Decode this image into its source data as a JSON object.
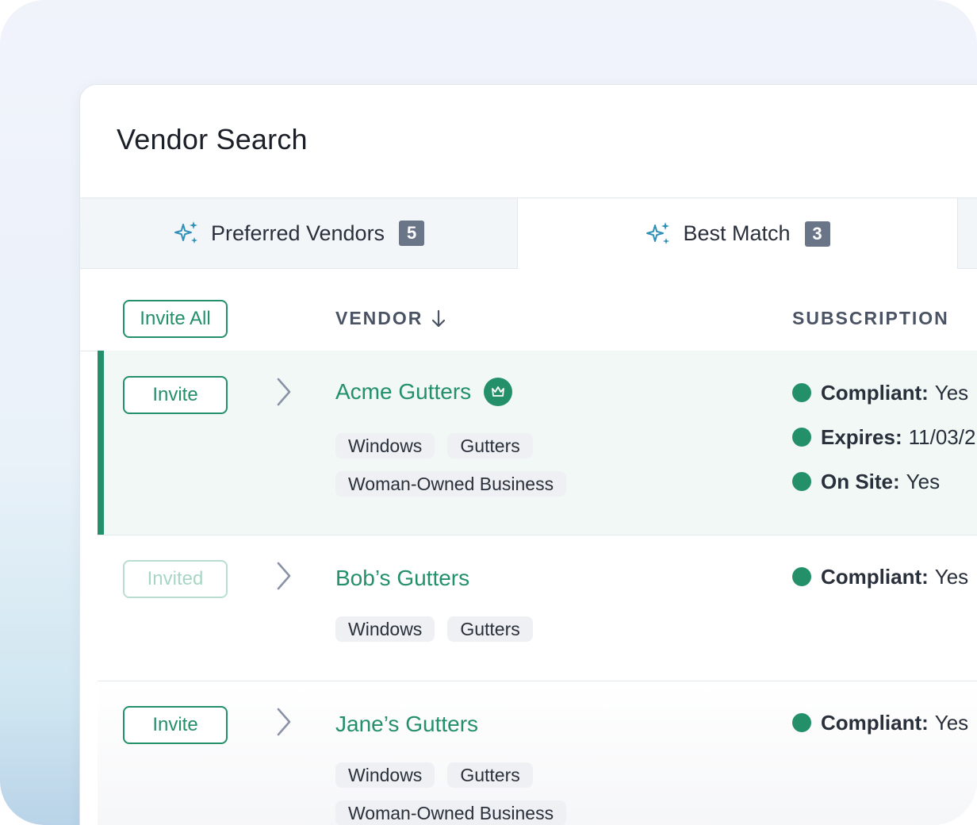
{
  "page": {
    "title": "Vendor Search"
  },
  "tabs": [
    {
      "label": "Preferred Vendors",
      "count": "5",
      "icon": "sparkle-icon"
    },
    {
      "label": "Best Match",
      "count": "3",
      "icon": "sparkle-icon"
    }
  ],
  "table": {
    "invite_all_label": "Invite All",
    "columns": {
      "vendor": "VENDOR",
      "subscription": "SUBSCRIPTION"
    }
  },
  "rows": [
    {
      "action": "Invite",
      "name": "Acme Gutters",
      "tags": [
        "Windows",
        "Gutters",
        "Woman-Owned Business"
      ],
      "statuses": [
        {
          "label": "Compliant:",
          "value": "Yes"
        },
        {
          "label": "Expires:",
          "value": "11/03/2"
        },
        {
          "label": "On Site:",
          "value": "Yes"
        }
      ]
    },
    {
      "action": "Invited",
      "name": "Bob’s Gutters",
      "tags": [
        "Windows",
        "Gutters"
      ],
      "statuses": [
        {
          "label": "Compliant:",
          "value": "Yes"
        }
      ]
    },
    {
      "action": "Invite",
      "name": "Jane’s Gutters",
      "tags": [
        "Windows",
        "Gutters",
        "Woman-Owned Business"
      ],
      "statuses": [
        {
          "label": "Compliant:",
          "value": "Yes"
        }
      ]
    }
  ],
  "colors": {
    "accent": "#23906a",
    "badge": "#6b7588",
    "sparkle": "#2e8fb8"
  }
}
